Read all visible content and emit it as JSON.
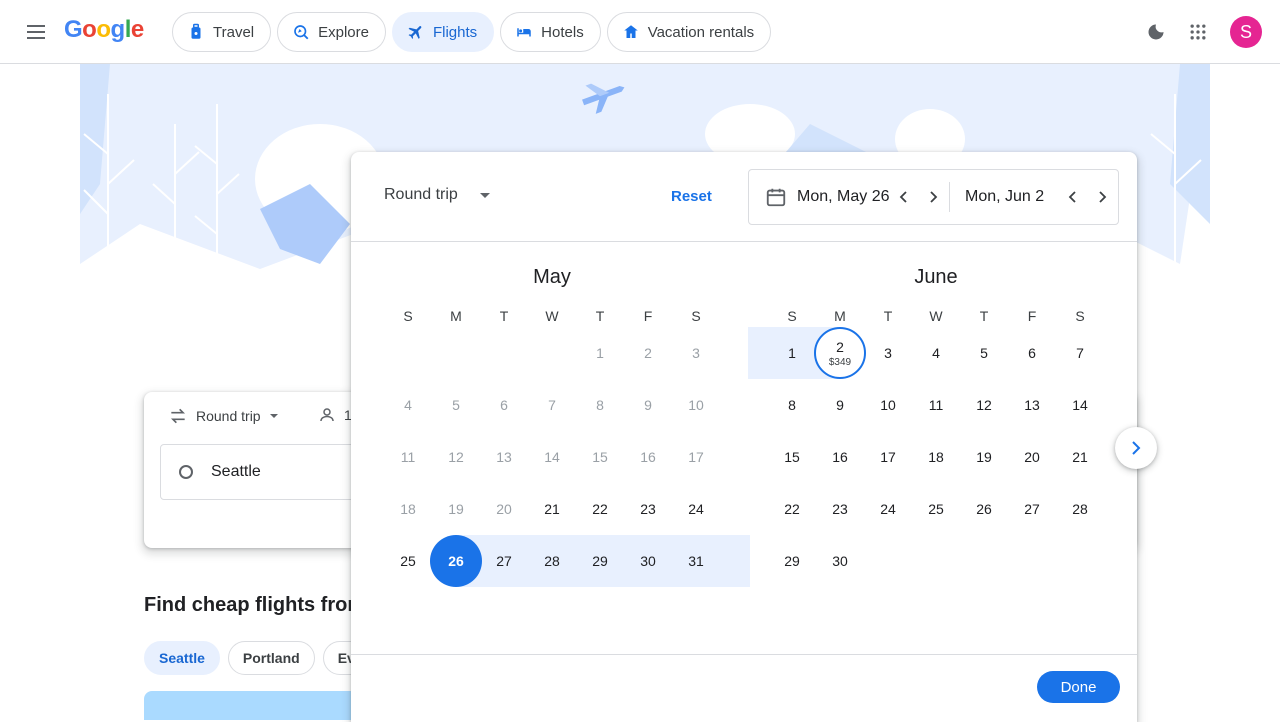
{
  "header": {
    "logo": "Google",
    "nav": [
      {
        "label": "Travel",
        "icon": "suitcase-icon",
        "active": false
      },
      {
        "label": "Explore",
        "icon": "explore-icon",
        "active": false
      },
      {
        "label": "Flights",
        "icon": "airplane-icon",
        "active": true
      },
      {
        "label": "Hotels",
        "icon": "bed-icon",
        "active": false
      },
      {
        "label": "Vacation rentals",
        "icon": "house-icon",
        "active": false
      }
    ],
    "avatar_letter": "S"
  },
  "search": {
    "trip_type": "Round trip",
    "passengers": "1",
    "origin": "Seattle"
  },
  "section": {
    "title": "Find cheap flights from",
    "cities": [
      "Seattle",
      "Portland",
      "Ev"
    ]
  },
  "dialog": {
    "trip_type": "Round trip",
    "reset_label": "Reset",
    "departure": "Mon, May 26",
    "return": "Mon, Jun 2",
    "done_label": "Done",
    "weekdays": [
      "S",
      "M",
      "T",
      "W",
      "T",
      "F",
      "S"
    ],
    "months": [
      {
        "name": "May",
        "first_weekday": 4,
        "days": 31,
        "past_until": 20
      },
      {
        "name": "June",
        "first_weekday": 0,
        "days": 30,
        "past_until": 0
      }
    ],
    "selected_start": {
      "month": 0,
      "day": 26
    },
    "selected_end": {
      "month": 1,
      "day": 2,
      "price": "$349"
    }
  },
  "colors": {
    "accent": "#1a73e8",
    "range": "#e8f0fe"
  }
}
